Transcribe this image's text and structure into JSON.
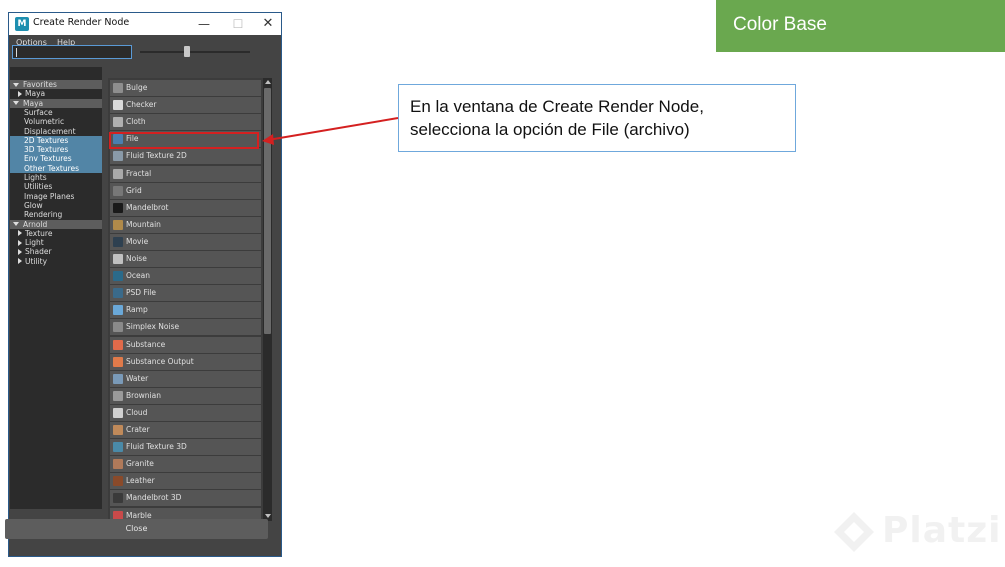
{
  "window": {
    "title": "Create Render Node",
    "controls": {
      "minimize": "—",
      "maximize": "☐",
      "close": "✕"
    },
    "menu": [
      "Options",
      "Help"
    ],
    "close_button": "Close"
  },
  "tree": [
    {
      "label": "Favorites",
      "kind": "section"
    },
    {
      "label": "Maya",
      "kind": "child-collapsed"
    },
    {
      "label": "Maya",
      "kind": "section"
    },
    {
      "label": "Surface",
      "kind": "item"
    },
    {
      "label": "Volumetric",
      "kind": "item"
    },
    {
      "label": "Displacement",
      "kind": "item"
    },
    {
      "label": "2D Textures",
      "kind": "selected"
    },
    {
      "label": "3D Textures",
      "kind": "selected"
    },
    {
      "label": "Env Textures",
      "kind": "selected"
    },
    {
      "label": "Other Textures",
      "kind": "selected"
    },
    {
      "label": "Lights",
      "kind": "item"
    },
    {
      "label": "Utilities",
      "kind": "item"
    },
    {
      "label": "Image Planes",
      "kind": "item"
    },
    {
      "label": "Glow",
      "kind": "item"
    },
    {
      "label": "Rendering",
      "kind": "item"
    },
    {
      "label": "Arnold",
      "kind": "section"
    },
    {
      "label": "Texture",
      "kind": "child-collapsed"
    },
    {
      "label": "Light",
      "kind": "child-collapsed"
    },
    {
      "label": "Shader",
      "kind": "child-collapsed"
    },
    {
      "label": "Utility",
      "kind": "child-collapsed"
    }
  ],
  "nodes": [
    {
      "label": "Bulge",
      "color": "#8e8e8e"
    },
    {
      "label": "Checker",
      "color": "#d9d9d9"
    },
    {
      "label": "Cloth",
      "color": "#b0b0b0"
    },
    {
      "label": "File",
      "color": "#4a7fb0"
    },
    {
      "label": "Fluid Texture 2D",
      "color": "#8a9aa8"
    },
    {
      "label": "Fractal",
      "color": "#a9a9a9"
    },
    {
      "label": "Grid",
      "color": "#777777"
    },
    {
      "label": "Mandelbrot",
      "color": "#1a1a1a"
    },
    {
      "label": "Mountain",
      "color": "#b08a4a"
    },
    {
      "label": "Movie",
      "color": "#2e4050"
    },
    {
      "label": "Noise",
      "color": "#c0c0c0"
    },
    {
      "label": "Ocean",
      "color": "#2a6a8a"
    },
    {
      "label": "PSD File",
      "color": "#3a6a8a"
    },
    {
      "label": "Ramp",
      "color": "#6aa8d8"
    },
    {
      "label": "Simplex Noise",
      "color": "#8a8a8a"
    },
    {
      "label": "Substance",
      "color": "#e06a4a"
    },
    {
      "label": "Substance Output",
      "color": "#e07a4a"
    },
    {
      "label": "Water",
      "color": "#7a9ab8"
    },
    {
      "label": "Brownian",
      "color": "#9a9a9a"
    },
    {
      "label": "Cloud",
      "color": "#d0d0d0"
    },
    {
      "label": "Crater",
      "color": "#c08a5a"
    },
    {
      "label": "Fluid Texture 3D",
      "color": "#4a8aa8"
    },
    {
      "label": "Granite",
      "color": "#b07a5a"
    },
    {
      "label": "Leather",
      "color": "#8a4a2a"
    },
    {
      "label": "Mandelbrot 3D",
      "color": "#3a3a3a"
    },
    {
      "label": "Marble",
      "color": "#c84a4a"
    }
  ],
  "badge": {
    "text": "Color Base",
    "color": "#6aa84f"
  },
  "callout": {
    "line1": "En la ventana de Create Render Node,",
    "line2": "selecciona la opción de File (archivo)"
  },
  "watermark": "Platzi",
  "colors": {
    "annotation_red": "#d42020",
    "callout_border": "#6fa8dc"
  }
}
